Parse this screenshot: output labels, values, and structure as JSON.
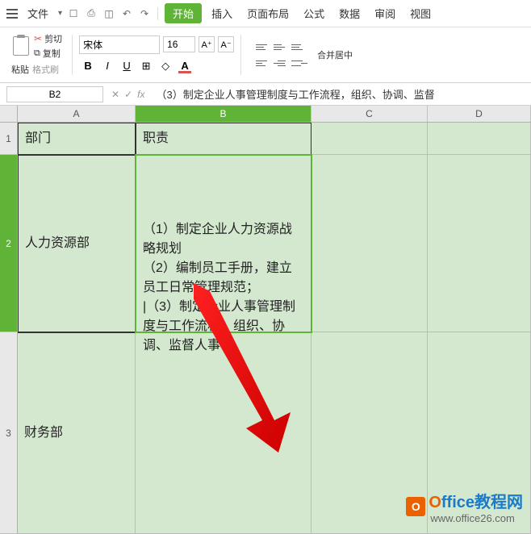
{
  "menubar": {
    "file": "文件",
    "tabs": [
      "开始",
      "插入",
      "页面布局",
      "公式",
      "数据",
      "审阅",
      "视图"
    ],
    "active_index": 0
  },
  "ribbon": {
    "paste": "粘贴",
    "cut": "剪切",
    "copy": "复制",
    "format_painter": "格式刷",
    "font_name": "宋体",
    "font_size": "16",
    "merge": "合并居中"
  },
  "namebox": "B2",
  "formula": "（3）制定企业人事管理制度与工作流程，组织、协调、监督",
  "columns": [
    "A",
    "B",
    "C",
    "D"
  ],
  "rows": [
    "1",
    "2",
    "3"
  ],
  "cells": {
    "a1": "部门",
    "b1": "职责",
    "a2": "人力资源部",
    "b2": "（1）制定企业人力资源战略规划\n（2）编制员工手册，建立员工日常管理规范；\n|（3）制定企业人事管理制度与工作流程，组织、协调、监督人事",
    "a3": "财务部"
  },
  "watermark": {
    "brand_o": "O",
    "brand_rest": "ffice教程网",
    "url": "www.office26.com"
  }
}
